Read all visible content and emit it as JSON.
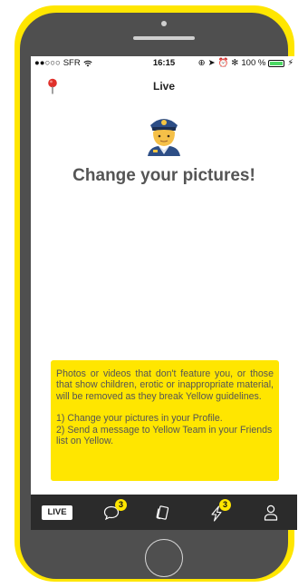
{
  "status_bar": {
    "carrier": "SFR",
    "time": "16:15",
    "battery": "100 %"
  },
  "nav": {
    "title": "Live"
  },
  "main": {
    "headline": "Change your pictures!",
    "notice_paragraph": "Photos or videos that don't feature you, or those that show children, erotic or inappropriate material, will be removed as they break Yellow guidelines.",
    "steps": [
      "1) Change your pictures in your Profile.",
      "2) Send a message to Yellow Team in your Friends list on Yellow."
    ]
  },
  "tab_bar": {
    "live_label": "LIVE",
    "messages_badge": "3",
    "activity_badge": "3"
  },
  "icons": {
    "location": "location-pin-icon",
    "police": "police-officer-icon",
    "messages": "speech-bubble-icon",
    "cards": "cards-icon",
    "activity": "lightning-icon",
    "profile": "person-icon"
  },
  "colors": {
    "brand_yellow": "#ffe600",
    "tab_bar": "#2b2b2b",
    "headline_gray": "#555555"
  }
}
